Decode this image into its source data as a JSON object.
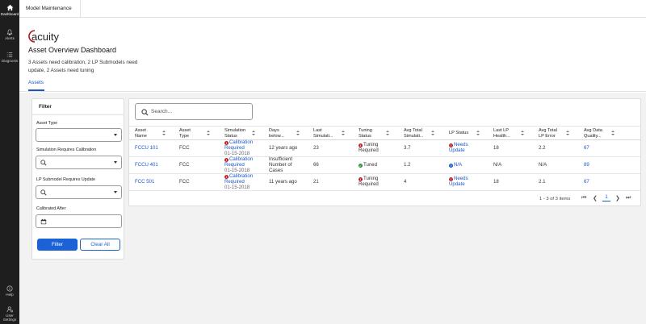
{
  "rail": {
    "dashboard": "Dashboard",
    "alerts": "Alerts",
    "diagnosis": "Diagnosis",
    "help": "Help",
    "user_settings_1": "User",
    "user_settings_2": "Settings"
  },
  "topbar": {
    "tab": "Model Maintenance"
  },
  "header": {
    "logo_text": "acuity",
    "title": "Asset Overview Dashboard",
    "summary": "3 Assets need calibration, 2 LP Submodels need update, 2 Assets need tuning"
  },
  "tabs": {
    "assets": "Assets"
  },
  "filter": {
    "title": "Filter",
    "asset_type_label": "Asset Type",
    "sim_cal_label": "Simulation Requires Calibration",
    "lp_update_label": "LP Submodel Requires Update",
    "calibrated_after_label": "Calibrated After",
    "filter_button": "Filter",
    "clear_button": "Clear All"
  },
  "grid": {
    "search_placeholder": "Search...",
    "headers": {
      "asset_name": [
        "Asset",
        "Name"
      ],
      "asset_type": [
        "Asset",
        "Type"
      ],
      "simulation_status": [
        "Simulation",
        "Status"
      ],
      "days_below": [
        "Days",
        "below..."
      ],
      "last_simulation": [
        "Last",
        "Simulati..."
      ],
      "tuning_status": [
        "Tuning",
        "Status"
      ],
      "avg_total_sim": [
        "Avg Total",
        "Simulati..."
      ],
      "lp_status": [
        "LP Status",
        ""
      ],
      "last_lp_health": [
        "Last LP",
        "Health..."
      ],
      "avg_total_lp_error": [
        "Avg Total",
        "LP Error"
      ],
      "avg_data_quality": [
        "Avg Data",
        "Quality..."
      ]
    },
    "rows": [
      {
        "asset_name": "FCCU 101",
        "asset_type": "FCC",
        "sim_status_1": "Calibration",
        "sim_status_2": "Required",
        "sim_date": "01-15-2018",
        "days_below": "12 years ago",
        "last_sim": "23",
        "tuning_1": "Tuning",
        "tuning_2": "Required",
        "avg_total_sim": "3.7",
        "lp_status_1": "Needs",
        "lp_status_2": "Update",
        "last_lp_health": "18",
        "avg_lp_error": "2.2",
        "avg_data_quality": "67"
      },
      {
        "asset_name": "FCCU 401",
        "asset_type": "FCC",
        "sim_status_1": "Calibration",
        "sim_status_2": "Required",
        "sim_date": "01-15-2018",
        "days_below_1": "Insufficient",
        "days_below_2": "Number of",
        "days_below_3": "Cases",
        "last_sim": "66",
        "tuning_1": "Tuned",
        "avg_total_sim": "1.2",
        "lp_status_1": "N/A",
        "last_lp_health": "N/A",
        "avg_lp_error": "N/A",
        "avg_data_quality": "89"
      },
      {
        "asset_name": "FCC 501",
        "asset_type": "FCC",
        "sim_status_1": "Calibration",
        "sim_status_2": "Required",
        "sim_date": "01-15-2018",
        "days_below": "11 years ago",
        "last_sim": "21",
        "tuning_1": "Tuning",
        "tuning_2": "Required",
        "avg_total_sim": "4",
        "lp_status_1": "Needs",
        "lp_status_2": "Update",
        "last_lp_health": "18",
        "avg_lp_error": "2.1",
        "avg_data_quality": "67"
      }
    ],
    "pager": {
      "range_text": "1 - 3 of 3 items",
      "current_page": "1"
    }
  },
  "colors": {
    "accent": "#1a56c9",
    "alert": "#c0272d",
    "ok": "#2e8b3c",
    "rail": "#1e1e1e"
  }
}
